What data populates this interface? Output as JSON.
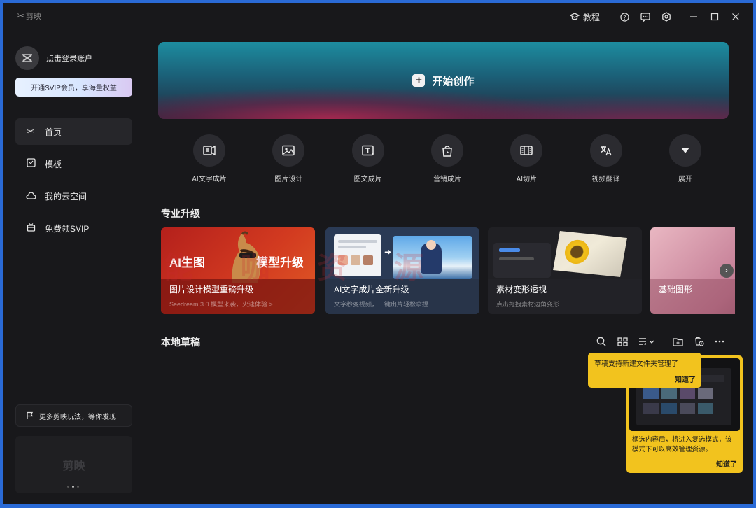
{
  "app": {
    "name": "剪映"
  },
  "titlebar": {
    "tutorial_label": "教程",
    "icons": [
      "help-icon",
      "feedback-icon",
      "settings-icon",
      "minimize-icon",
      "maximize-icon",
      "close-icon"
    ]
  },
  "sidebar": {
    "login_label": "点击登录账户",
    "svip_button": "开通SVIP会员，享海量权益",
    "items": [
      {
        "label": "首页",
        "icon": "scissors-icon",
        "active": true
      },
      {
        "label": "模板",
        "icon": "template-icon",
        "active": false
      },
      {
        "label": "我的云空间",
        "icon": "cloud-icon",
        "active": false
      },
      {
        "label": "免费领SVIP",
        "icon": "gift-icon",
        "active": false
      }
    ],
    "more_tips": "更多剪映玩法，等你发现",
    "banner_logo": "剪映"
  },
  "main": {
    "hero_label": "开始创作",
    "tools": [
      {
        "label": "AI文字成片",
        "icon": "ai-text-video-icon"
      },
      {
        "label": "图片设计",
        "icon": "image-design-icon"
      },
      {
        "label": "图文成片",
        "icon": "text-image-video-icon"
      },
      {
        "label": "营销成片",
        "icon": "marketing-video-icon"
      },
      {
        "label": "AI切片",
        "icon": "ai-clip-icon"
      },
      {
        "label": "视频翻译",
        "icon": "translate-icon"
      },
      {
        "label": "展开",
        "icon": "expand-icon"
      }
    ],
    "pro_section_title": "专业升级",
    "cards": [
      {
        "title": "图片设计模型重磅升级",
        "sub": "Seedream 3.0 模型来袭，火速体验 >",
        "big_left": "AI生图",
        "big_right": "模型升级"
      },
      {
        "title": "AI文字成片全新升级",
        "sub": "文字秒变视频，一键出片轻松拿捏",
        "big_left": "",
        "big_right": ""
      },
      {
        "title": "素材变形透视",
        "sub": "点击拖拽素材边角变形",
        "big_left": "",
        "big_right": ""
      },
      {
        "title": "基础图形",
        "sub": "",
        "big_left": "",
        "big_right": ""
      }
    ],
    "watermark": "能 咖 资 源",
    "drafts_title": "本地草稿",
    "draft_tools": [
      "search-icon",
      "grid-view-icon",
      "sort-icon",
      "new-folder-icon",
      "cloud-delete-icon",
      "more-icon"
    ]
  },
  "tips": {
    "folder_tip": "草稿支持新建文件夹管理了",
    "folder_ok": "知道了",
    "multi_tip": "框选内容后，将进入复选模式，该模式下可以高效管理资源。",
    "multi_ok": "知道了"
  },
  "colors": {
    "accent_tip": "#f2c31e",
    "window_bg": "#18181b",
    "frame": "#2a6ad6"
  }
}
